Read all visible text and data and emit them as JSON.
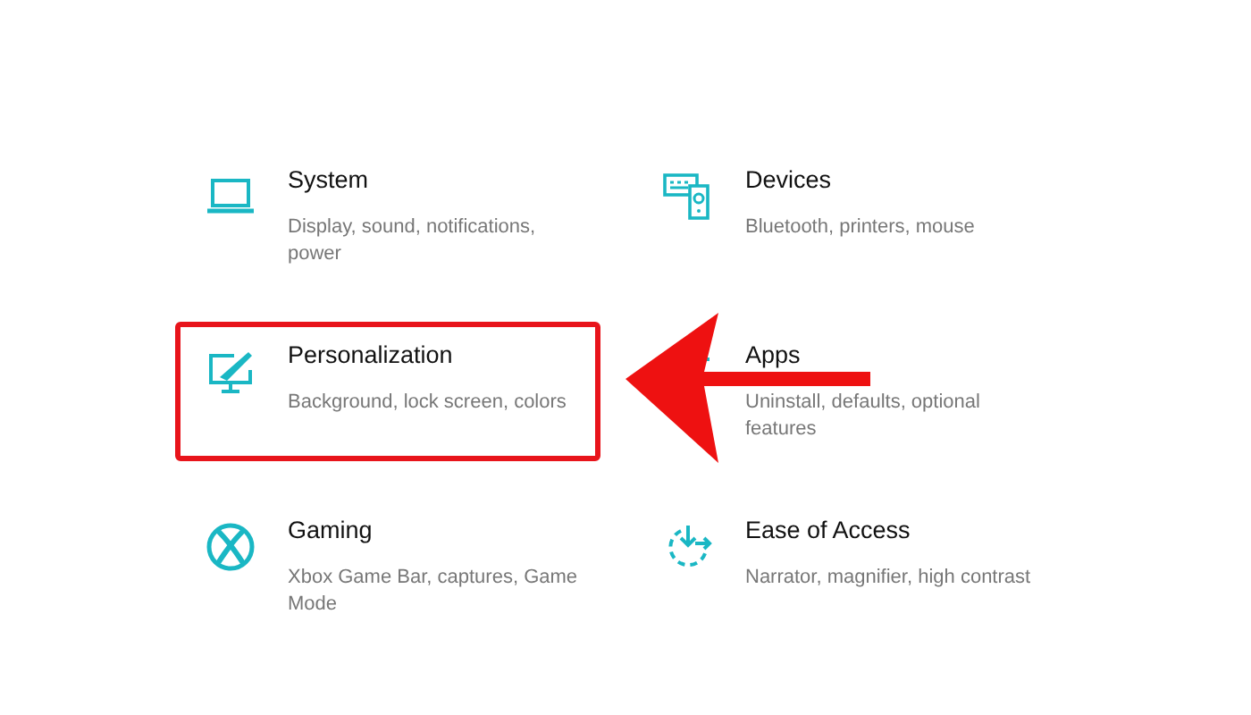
{
  "categories": [
    {
      "kind": "system",
      "title": "System",
      "subtitle": "Display, sound, notifications, power",
      "highlighted": false
    },
    {
      "kind": "devices",
      "title": "Devices",
      "subtitle": "Bluetooth, printers, mouse",
      "highlighted": false
    },
    {
      "kind": "personalization",
      "title": "Personalization",
      "subtitle": "Background, lock screen, colors",
      "highlighted": true
    },
    {
      "kind": "apps",
      "title": "Apps",
      "subtitle": "Uninstall, defaults, optional features",
      "highlighted": false
    },
    {
      "kind": "gaming",
      "title": "Gaming",
      "subtitle": "Xbox Game Bar, captures, Game Mode",
      "highlighted": false
    },
    {
      "kind": "ease",
      "title": "Ease of Access",
      "subtitle": "Narrator, magnifier, high contrast",
      "highlighted": false
    }
  ]
}
